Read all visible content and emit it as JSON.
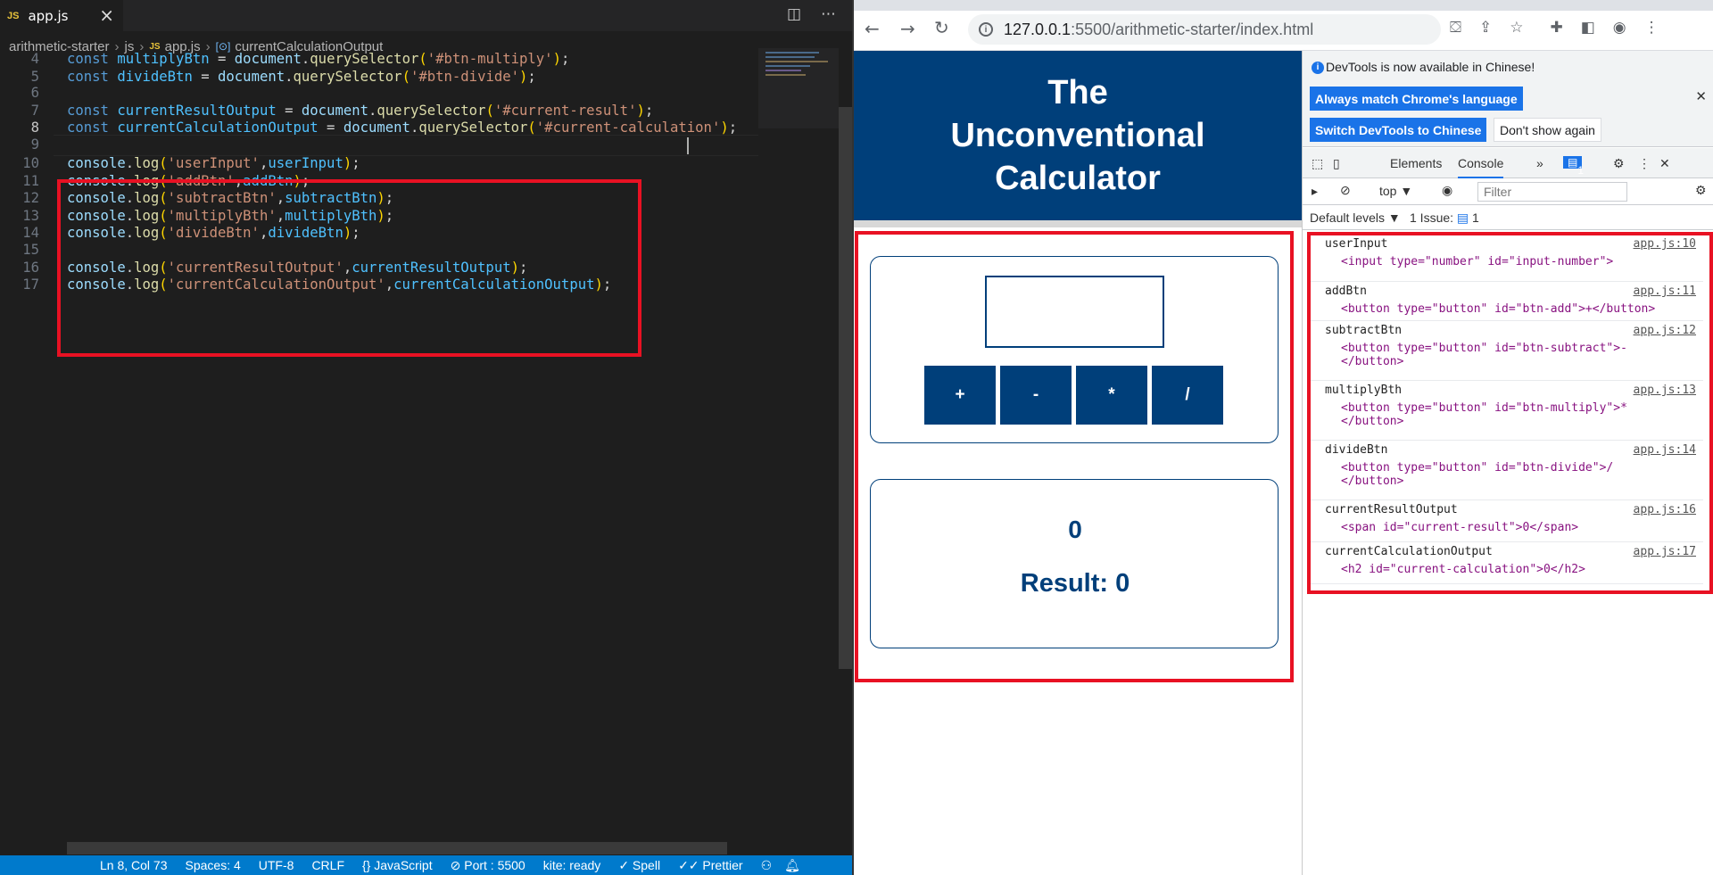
{
  "editor": {
    "tab_icon": "JS",
    "tab_name": "app.js",
    "breadcrumb": [
      "arithmetic-starter",
      "js",
      "app.js",
      "currentCalculationOutput"
    ],
    "breadcrumb_js": "JS",
    "lines": [
      {
        "n": "4",
        "code": [
          {
            "c": "kw",
            "t": "const "
          },
          {
            "c": "vr",
            "t": "multiplyBtn"
          },
          {
            "c": "pl",
            "t": " = "
          },
          {
            "c": "vl",
            "t": "document"
          },
          {
            "c": "pl",
            "t": "."
          },
          {
            "c": "fn",
            "t": "querySelector"
          },
          {
            "c": "br",
            "t": "("
          },
          {
            "c": "str",
            "t": "'#btn-multiply'"
          },
          {
            "c": "br",
            "t": ")"
          },
          {
            "c": "pl",
            "t": ";"
          }
        ]
      },
      {
        "n": "5",
        "code": [
          {
            "c": "kw",
            "t": "const "
          },
          {
            "c": "vr",
            "t": "divideBtn"
          },
          {
            "c": "pl",
            "t": " = "
          },
          {
            "c": "vl",
            "t": "document"
          },
          {
            "c": "pl",
            "t": "."
          },
          {
            "c": "fn",
            "t": "querySelector"
          },
          {
            "c": "br",
            "t": "("
          },
          {
            "c": "str",
            "t": "'#btn-divide'"
          },
          {
            "c": "br",
            "t": ")"
          },
          {
            "c": "pl",
            "t": ";"
          }
        ]
      },
      {
        "n": "6",
        "code": []
      },
      {
        "n": "7",
        "code": [
          {
            "c": "kw",
            "t": "const "
          },
          {
            "c": "vr",
            "t": "currentResultOutput"
          },
          {
            "c": "pl",
            "t": " = "
          },
          {
            "c": "vl",
            "t": "document"
          },
          {
            "c": "pl",
            "t": "."
          },
          {
            "c": "fn",
            "t": "querySelector"
          },
          {
            "c": "br",
            "t": "("
          },
          {
            "c": "str",
            "t": "'#current-result'"
          },
          {
            "c": "br",
            "t": ")"
          },
          {
            "c": "pl",
            "t": ";"
          }
        ]
      },
      {
        "n": "8",
        "code": [
          {
            "c": "kw",
            "t": "const "
          },
          {
            "c": "vr",
            "t": "currentCalculationOutput"
          },
          {
            "c": "pl",
            "t": " = "
          },
          {
            "c": "vl",
            "t": "document"
          },
          {
            "c": "pl",
            "t": "."
          },
          {
            "c": "fn",
            "t": "querySelector"
          },
          {
            "c": "br",
            "t": "("
          },
          {
            "c": "str",
            "t": "'#current-calculation'"
          },
          {
            "c": "br",
            "t": ")"
          },
          {
            "c": "pl",
            "t": ";"
          }
        ]
      },
      {
        "n": "9",
        "code": []
      },
      {
        "n": "10",
        "code": [
          {
            "c": "vl",
            "t": "console"
          },
          {
            "c": "pl",
            "t": "."
          },
          {
            "c": "fn",
            "t": "log"
          },
          {
            "c": "br",
            "t": "("
          },
          {
            "c": "str",
            "t": "'userInput'"
          },
          {
            "c": "pl",
            "t": ","
          },
          {
            "c": "vr",
            "t": "userInput"
          },
          {
            "c": "br",
            "t": ")"
          },
          {
            "c": "pl",
            "t": ";"
          }
        ]
      },
      {
        "n": "11",
        "code": [
          {
            "c": "vl",
            "t": "console"
          },
          {
            "c": "pl",
            "t": "."
          },
          {
            "c": "fn",
            "t": "log"
          },
          {
            "c": "br",
            "t": "("
          },
          {
            "c": "str",
            "t": "'addBtn'"
          },
          {
            "c": "pl",
            "t": ","
          },
          {
            "c": "vr",
            "t": "addBtn"
          },
          {
            "c": "br",
            "t": ")"
          },
          {
            "c": "pl",
            "t": ";"
          }
        ]
      },
      {
        "n": "12",
        "code": [
          {
            "c": "vl",
            "t": "console"
          },
          {
            "c": "pl",
            "t": "."
          },
          {
            "c": "fn",
            "t": "log"
          },
          {
            "c": "br",
            "t": "("
          },
          {
            "c": "str",
            "t": "'subtractBtn'"
          },
          {
            "c": "pl",
            "t": ","
          },
          {
            "c": "vr",
            "t": "subtractBtn"
          },
          {
            "c": "br",
            "t": ")"
          },
          {
            "c": "pl",
            "t": ";"
          }
        ]
      },
      {
        "n": "13",
        "code": [
          {
            "c": "vl",
            "t": "console"
          },
          {
            "c": "pl",
            "t": "."
          },
          {
            "c": "fn",
            "t": "log"
          },
          {
            "c": "br",
            "t": "("
          },
          {
            "c": "str",
            "t": "'multiplyBth'"
          },
          {
            "c": "pl",
            "t": ","
          },
          {
            "c": "vr",
            "t": "multiplyBth"
          },
          {
            "c": "br",
            "t": ")"
          },
          {
            "c": "pl",
            "t": ";"
          }
        ]
      },
      {
        "n": "14",
        "code": [
          {
            "c": "vl",
            "t": "console"
          },
          {
            "c": "pl",
            "t": "."
          },
          {
            "c": "fn",
            "t": "log"
          },
          {
            "c": "br",
            "t": "("
          },
          {
            "c": "str",
            "t": "'divideBtn'"
          },
          {
            "c": "pl",
            "t": ","
          },
          {
            "c": "vr",
            "t": "divideBtn"
          },
          {
            "c": "br",
            "t": ")"
          },
          {
            "c": "pl",
            "t": ";"
          }
        ]
      },
      {
        "n": "15",
        "code": []
      },
      {
        "n": "16",
        "code": [
          {
            "c": "vl",
            "t": "console"
          },
          {
            "c": "pl",
            "t": "."
          },
          {
            "c": "fn",
            "t": "log"
          },
          {
            "c": "br",
            "t": "("
          },
          {
            "c": "str",
            "t": "'currentResultOutput'"
          },
          {
            "c": "pl",
            "t": ","
          },
          {
            "c": "vr",
            "t": "currentResultOutput"
          },
          {
            "c": "br",
            "t": ")"
          },
          {
            "c": "pl",
            "t": ";"
          }
        ]
      },
      {
        "n": "17",
        "code": [
          {
            "c": "vl",
            "t": "console"
          },
          {
            "c": "pl",
            "t": "."
          },
          {
            "c": "fn",
            "t": "log"
          },
          {
            "c": "br",
            "t": "("
          },
          {
            "c": "str",
            "t": "'currentCalculationOutput'"
          },
          {
            "c": "pl",
            "t": ","
          },
          {
            "c": "vr",
            "t": "currentCalculationOutput"
          },
          {
            "c": "br",
            "t": ")"
          },
          {
            "c": "pl",
            "t": ";"
          }
        ]
      }
    ],
    "status": {
      "position": "Ln 8, Col 73",
      "spaces": "Spaces: 4",
      "encoding": "UTF-8",
      "eol": "CRLF",
      "language": "{} JavaScript",
      "port": "⊘ Port : 5500",
      "kite": "kite: ready",
      "spell": "✓ Spell",
      "prettier": "✓✓ Prettier"
    }
  },
  "browser": {
    "url_host": "127.0.0.1",
    "url_path": ":5500/arithmetic-starter/index.html",
    "page": {
      "title": "The Unconventional Calculator",
      "buttons": [
        "+",
        "-",
        "*",
        "/"
      ],
      "current_calculation": "0",
      "result": "Result: 0"
    }
  },
  "devtools": {
    "info_message": "DevTools is now available in Chinese!",
    "btn_match": "Always match Chrome's language",
    "btn_switch": "Switch DevTools to Chinese",
    "btn_dont_show": "Don't show again",
    "tab_elements": "Elements",
    "tab_console": "Console",
    "issue_badge": "1",
    "context": "top ▼",
    "filter_placeholder": "Filter",
    "levels": "Default levels ▼",
    "issues": "1 Issue:",
    "issues_count": "1",
    "logs": [
      {
        "label": "userInput",
        "src": "app.js:10",
        "html": "<input type=\"number\" id=\"input-number\">"
      },
      {
        "label": "addBtn",
        "src": "app.js:11",
        "html": "<button type=\"button\" id=\"btn-add\">+</button>"
      },
      {
        "label": "subtractBtn",
        "src": "app.js:12",
        "html": "<button type=\"button\" id=\"btn-subtract\">-\n</button>"
      },
      {
        "label": "multiplyBth",
        "src": "app.js:13",
        "html": "<button type=\"button\" id=\"btn-multiply\">*\n</button>"
      },
      {
        "label": "divideBtn",
        "src": "app.js:14",
        "html": "<button type=\"button\" id=\"btn-divide\">/\n</button>"
      },
      {
        "label": "currentResultOutput",
        "src": "app.js:16",
        "html": "<span id=\"current-result\">0</span>"
      },
      {
        "label": "currentCalculationOutput",
        "src": "app.js:17",
        "html": "<h2 id=\"current-calculation\">0</h2>"
      }
    ]
  }
}
